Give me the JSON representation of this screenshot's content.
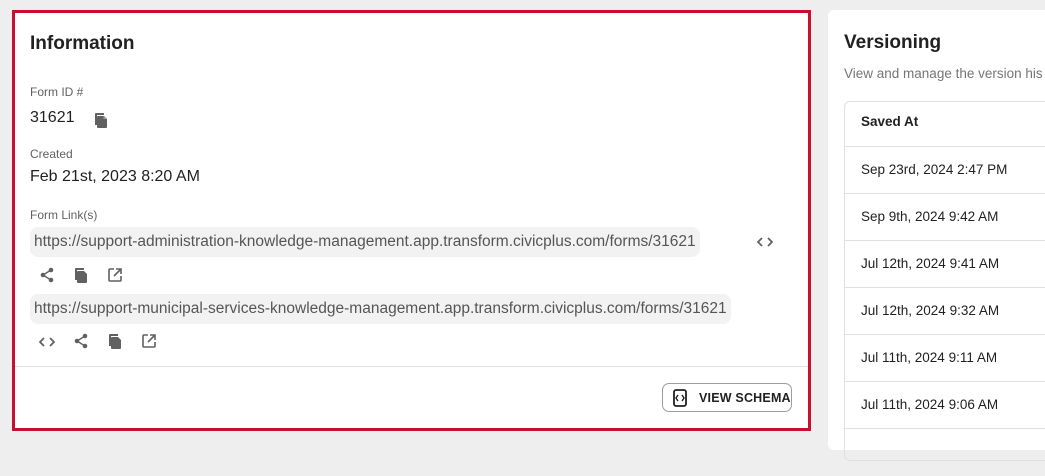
{
  "information": {
    "title": "Information",
    "form_id_label": "Form ID #",
    "form_id_value": "31621",
    "created_label": "Created",
    "created_value": "Feb 21st, 2023 8:20 AM",
    "form_links_label": "Form Link(s)",
    "links": [
      {
        "url": "https://support-administration-knowledge-management.app.transform.civicplus.com/forms/31621"
      },
      {
        "url": "https://support-municipal-services-knowledge-management.app.transform.civicplus.com/forms/31621"
      }
    ],
    "view_schema_label": "VIEW SCHEMA",
    "icons": [
      "copy-icon",
      "code-icon",
      "share-icon",
      "open-external-icon",
      "schema-icon"
    ]
  },
  "versioning": {
    "title": "Versioning",
    "description": "View and manage the version his",
    "column_header": "Saved At",
    "rows": [
      "Sep 23rd, 2024 2:47 PM",
      "Sep 9th, 2024 9:42 AM",
      "Jul 12th, 2024 9:41 AM",
      "Jul 12th, 2024 9:32 AM",
      "Jul 11th, 2024 9:11 AM",
      "Jul 11th, 2024 9:06 AM"
    ]
  },
  "colors": {
    "highlight_border": "#c8102e",
    "background": "#eeeeee",
    "link_background": "#f2f2f2"
  }
}
